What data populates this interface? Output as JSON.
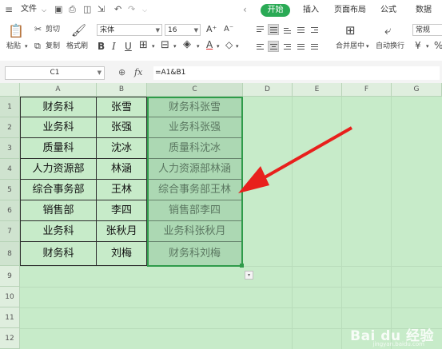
{
  "menubar": {
    "file": "文件",
    "tabs": [
      "开始",
      "插入",
      "页面布局",
      "公式",
      "数据"
    ]
  },
  "ribbon": {
    "paste": "粘贴",
    "cut": "剪切",
    "copy": "复制",
    "format_painter": "格式刷",
    "font_name": "宋体",
    "font_size": "16",
    "merge_center": "合并居中",
    "wrap_text": "自动换行",
    "number_format": "常规"
  },
  "formula_bar": {
    "cell_ref": "C1",
    "fx": "fx",
    "formula": "=A1&B1"
  },
  "sheet": {
    "columns": [
      "A",
      "B",
      "C",
      "D",
      "E",
      "F",
      "G"
    ],
    "rows": [
      "1",
      "2",
      "3",
      "4",
      "5",
      "6",
      "7",
      "8",
      "9",
      "10",
      "11",
      "12"
    ],
    "data": [
      [
        "财务科",
        "张雪",
        "财务科张雪"
      ],
      [
        "业务科",
        "张强",
        "业务科张强"
      ],
      [
        "质量科",
        "沈冰",
        "质量科沈冰"
      ],
      [
        "人力资源部",
        "林涵",
        "人力资源部林涵"
      ],
      [
        "综合事务部",
        "王林",
        "综合事务部王林"
      ],
      [
        "销售部",
        "李四",
        "销售部李四"
      ],
      [
        "业务科",
        "张秋月",
        "业务科张秋月"
      ],
      [
        "财务科",
        "刘梅",
        "财务科刘梅"
      ]
    ]
  },
  "colors": {
    "accent": "#2aaa55",
    "sheet_bg": "#c7ebc9",
    "arrow": "#e8201c"
  },
  "watermark": {
    "logo": "Bai du 经验",
    "url": "jingyan.baidu.com"
  }
}
